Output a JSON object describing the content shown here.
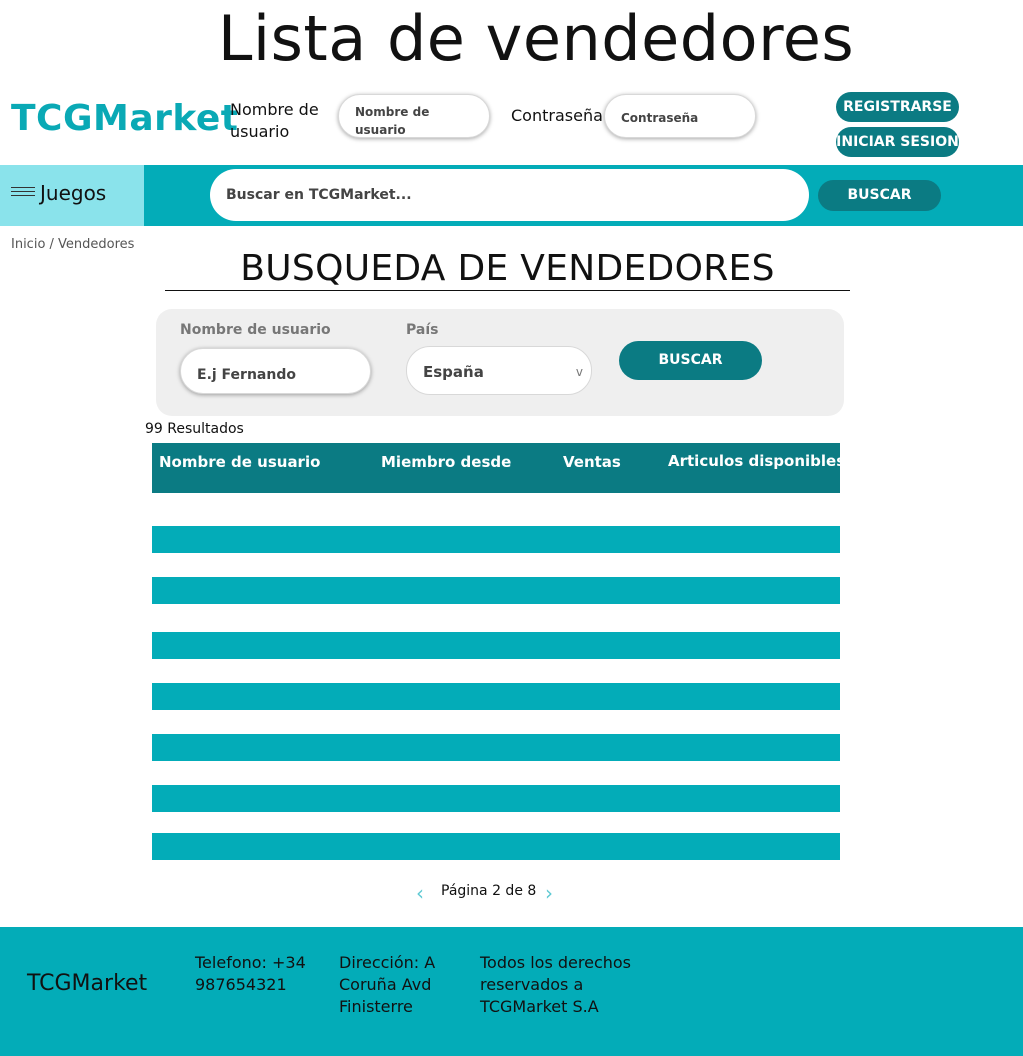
{
  "page_title": "Lista de vendedores",
  "header": {
    "logo": "TCGMarket",
    "username_label": "Nombre de usuario",
    "username_placeholder": "Nombre de usuario",
    "password_label": "Contraseña:",
    "password_placeholder": "Contraseña",
    "register_button": "REGISTRARSE",
    "login_button": "INICIAR SESION"
  },
  "nav": {
    "games_label": "Juegos",
    "search_placeholder": "Buscar en TCGMarket...",
    "search_button": "BUSCAR"
  },
  "breadcrumb": "Inicio / Vendedores",
  "section_title": "BUSQUEDA DE VENDEDORES",
  "filters": {
    "username_label": "Nombre de usuario",
    "username_placeholder": "E.j Fernando",
    "country_label": "País",
    "country_value": "España",
    "search_button": "BUSCAR"
  },
  "results": {
    "count": "99 Resultados",
    "columns": [
      "Nombre de usuario",
      "Miembro desde",
      "Ventas",
      "Articulos disponibles"
    ],
    "row_count": 7
  },
  "pagination": {
    "text": "Página 2 de 8"
  },
  "footer": {
    "logo": "TCGMarket",
    "phone": "Telefono: +34 987654321",
    "address": "Dirección: A Coruña Avd Finisterre",
    "rights": "Todos los derechos reservados a TCGMarket S.A"
  },
  "colors": {
    "teal": "#03acb8",
    "dark_teal": "#0b7b83",
    "light_teal": "#8ae3eb",
    "filter_bg": "#efefef"
  }
}
